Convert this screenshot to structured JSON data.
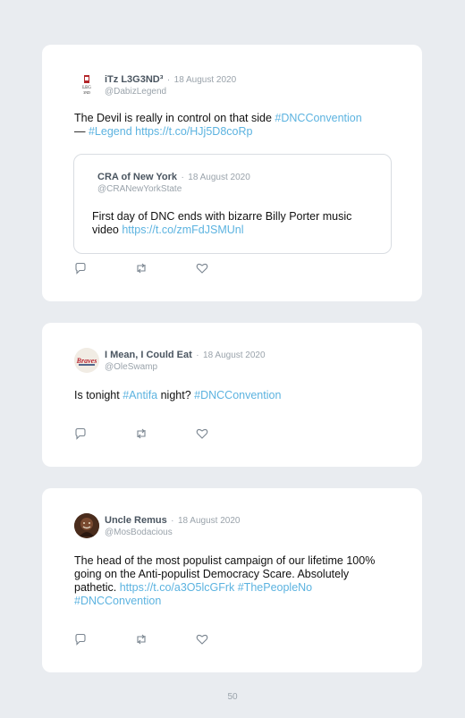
{
  "tweets": [
    {
      "display_name": "iTz L3G3ND³",
      "date": "18 August 2020",
      "handle": "@DabizLegend",
      "text_plain": "The Devil is really in control on that side ",
      "text_link1": "#DNCConvention",
      "text_dash": " — ",
      "text_link2": "#Legend",
      "text_space": " ",
      "text_link3": "https://t.co/HJj5D8coRp",
      "quote": {
        "display_name": "CRA of New York",
        "date": "18 August 2020",
        "handle": "@CRANewYorkState",
        "text_plain": "First day of DNC ends with bizarre Billy Porter music video ",
        "text_link": "https://t.co/zmFdJSMUnl"
      }
    },
    {
      "display_name": "I Mean, I Could Eat",
      "date": "18 August 2020",
      "handle": "@OleSwamp",
      "text_plain1": "Is tonight ",
      "text_link1": "#Antifa",
      "text_plain2": " night? ",
      "text_link2": "#DNCConvention"
    },
    {
      "display_name": "Uncle Remus",
      "date": "18 August 2020",
      "handle": "@MosBodacious",
      "text_plain": "The head of the most populist campaign of our lifetime 100% going on the Anti-populist Democracy Scare. Absolutely pathetic. ",
      "text_link1": "https://t.co/a3O5lcGFrk",
      "text_space": " ",
      "text_link2": "#ThePeopleNo",
      "text_link3": "#DNCConvention"
    }
  ],
  "separator": "·",
  "page_number": "50",
  "icons": [
    "reply-icon",
    "retweet-icon",
    "like-icon"
  ],
  "colors": {
    "link": "#5cb3e0",
    "background": "#e9ecf0",
    "card": "#ffffff"
  }
}
